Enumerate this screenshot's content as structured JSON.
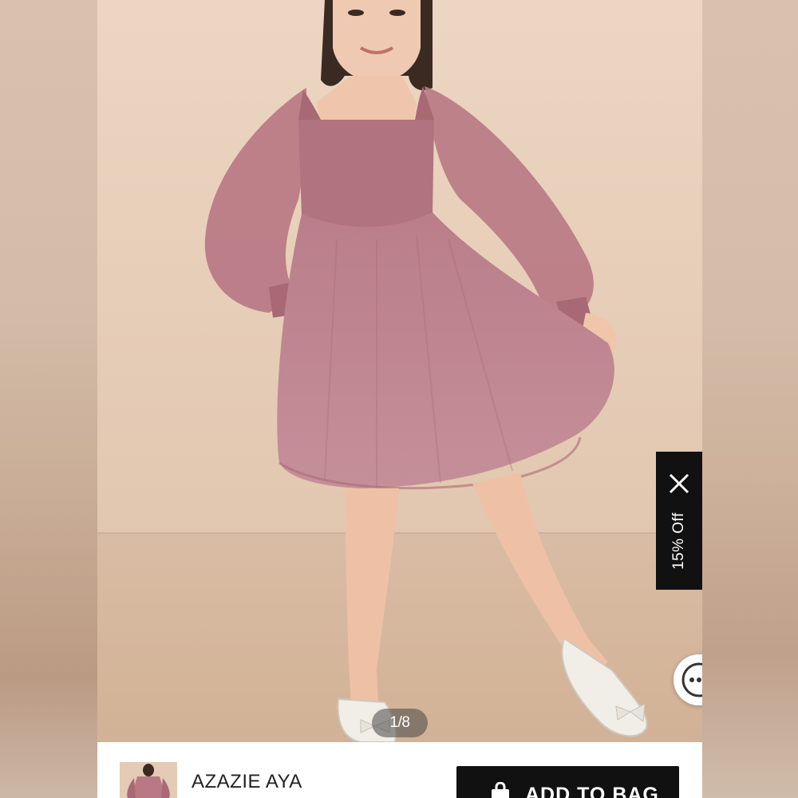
{
  "gallery": {
    "image_alt": "Girl wearing a pink tulle dress with sheer puff sleeves",
    "counter": "1/8"
  },
  "promo": {
    "label": "15% Off",
    "close_icon": "close-icon"
  },
  "chat": {
    "icon": "chat-icon"
  },
  "product": {
    "name": "AZAZIE AYA",
    "add_to_bag_label": "ADD TO BAG",
    "bag_icon": "shopping-bag-icon"
  },
  "colors": {
    "wall": "#e7cfb9",
    "floor": "#d6b8a0",
    "dress": "#b57a86",
    "button": "#111111"
  }
}
